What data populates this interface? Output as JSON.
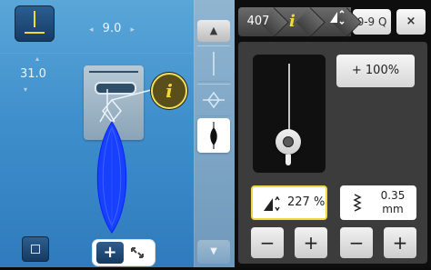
{
  "stitch": {
    "width_value": "9.0",
    "length_value": "31.0"
  },
  "zoom": {
    "in_label": "+"
  },
  "panel": {
    "breadcrumb_number": "407",
    "breadcrumb_info_label": "i",
    "search_label": "0-9 Q",
    "close_label": "×",
    "percent_button_label": "+ 100%",
    "length_field_value": "227 %",
    "stitch_field_value_line1": "0.35",
    "stitch_field_value_line2": "mm",
    "buttons": {
      "length_minus": "−",
      "length_plus": "+",
      "stitch_minus": "−",
      "stitch_plus": "+"
    }
  },
  "info_button": {
    "label": "i"
  },
  "colors": {
    "highlight_yellow": "#f1d83d",
    "blue_stitch": "#1740ff"
  }
}
